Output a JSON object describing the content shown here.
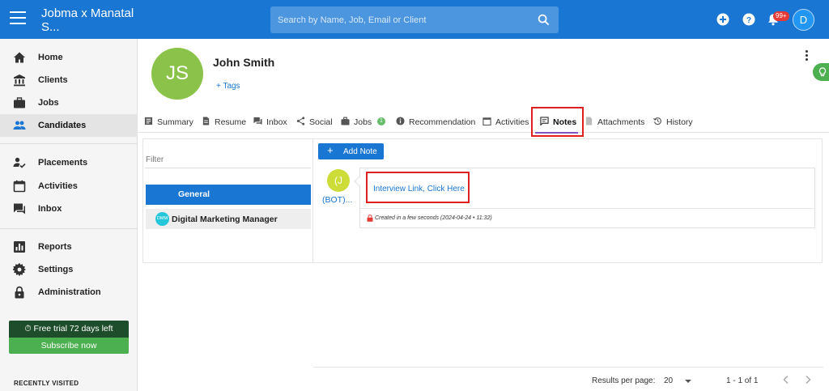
{
  "topbar": {
    "title": "Jobma x Manatal S...",
    "search_placeholder": "Search by Name, Job, Email or Client",
    "notification_count": "99+",
    "user_initial": "D"
  },
  "sidebar": {
    "group1": [
      {
        "label": "Home",
        "icon": "home-icon"
      },
      {
        "label": "Clients",
        "icon": "bank-icon"
      },
      {
        "label": "Jobs",
        "icon": "briefcase-icon"
      },
      {
        "label": "Candidates",
        "icon": "people-icon",
        "active": true
      }
    ],
    "group2": [
      {
        "label": "Placements",
        "icon": "person-check-icon"
      },
      {
        "label": "Activities",
        "icon": "calendar-icon"
      },
      {
        "label": "Inbox",
        "icon": "chat-icon"
      }
    ],
    "group3": [
      {
        "label": "Reports",
        "icon": "bar-chart-icon"
      },
      {
        "label": "Settings",
        "icon": "gear-icon"
      },
      {
        "label": "Administration",
        "icon": "lock-icon"
      }
    ],
    "trial_text": "Free trial 72 days left",
    "subscribe_label": "Subscribe now",
    "recently_visited": "RECENTLY VISITED"
  },
  "candidate": {
    "initials": "JS",
    "name": "John Smith",
    "tags_label": "+ Tags"
  },
  "tabs": [
    {
      "label": "Summary",
      "icon": "summary-icon"
    },
    {
      "label": "Resume",
      "icon": "document-icon"
    },
    {
      "label": "Inbox",
      "icon": "inbox-icon"
    },
    {
      "label": "Social",
      "icon": "share-icon"
    },
    {
      "label": "Jobs",
      "icon": "briefcase-icon",
      "badge": "1"
    },
    {
      "label": "Recommendation",
      "icon": "info-icon"
    },
    {
      "label": "Activities",
      "icon": "calendar-icon"
    },
    {
      "label": "Notes",
      "icon": "note-icon",
      "active": true
    },
    {
      "label": "Attachments",
      "icon": "paperclip-icon"
    },
    {
      "label": "History",
      "icon": "history-icon"
    }
  ],
  "notes": {
    "filter_placeholder": "Filter",
    "filter_general": "General",
    "filter_job_badge": "DMM",
    "filter_job": "Digital Marketing Manager",
    "add_note_label": "Add Note",
    "bot_initial": "(J",
    "bot_label": "(BOT)...",
    "note_link": "Interview Link, Click Here",
    "note_meta": "Created in a few seconds (2024-04-24 • 11:32)"
  },
  "pagination": {
    "results_label": "Results per page:",
    "per_page": "20",
    "range": "1 - 1 of 1"
  },
  "colors": {
    "primary": "#1976d2",
    "highlight": "#e02020",
    "trial_bg": "#1e4d2b",
    "subscribe_bg": "#4caf50",
    "avatar_bg": "#8bc34a"
  }
}
